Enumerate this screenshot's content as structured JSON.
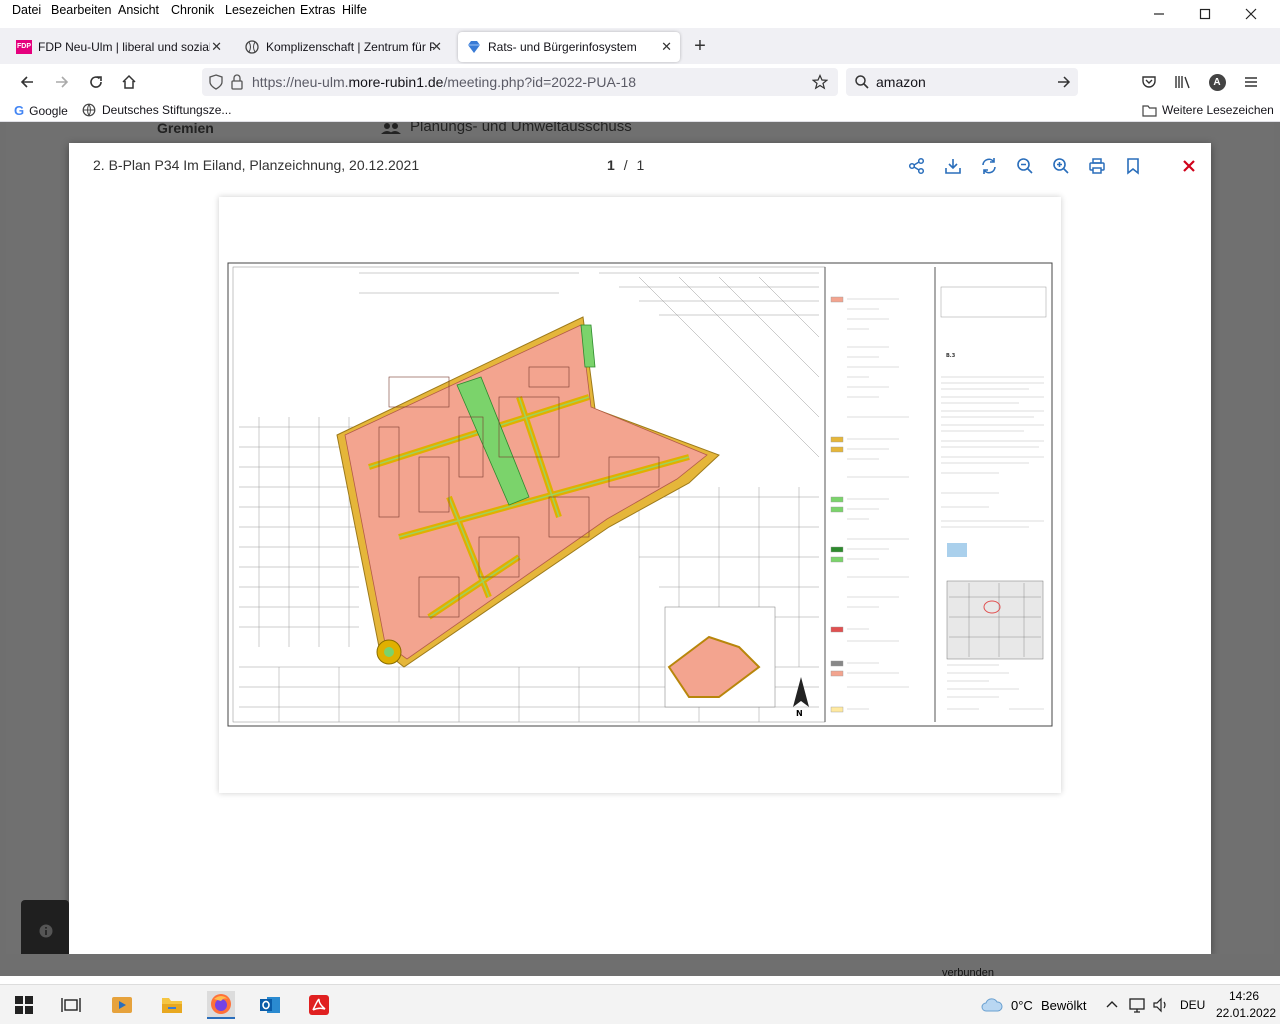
{
  "menubar": {
    "items": [
      "Datei",
      "Bearbeiten",
      "Ansicht",
      "Chronik",
      "Lesezeichen",
      "Extras",
      "Hilfe"
    ]
  },
  "tabs": [
    {
      "label": "FDP Neu-Ulm | liberal und sozial",
      "icon_text": "FDP",
      "active": false
    },
    {
      "label": "Komplizenschaft | Zentrum für P",
      "active": false
    },
    {
      "label": "Rats- und Bürgerinfosystem",
      "active": true
    }
  ],
  "url": {
    "prefix": "https://neu-ulm.",
    "domain": "more-rubin1.de",
    "path": "/meeting.php?id=2022-PUA-18"
  },
  "search": {
    "value": "amazon"
  },
  "account_initial": "A",
  "bookmarks": [
    {
      "label": "Google"
    },
    {
      "label": "Deutsches Stiftungsze..."
    }
  ],
  "bookmarks_other": "Weitere Lesezeichen",
  "background_page": {
    "label": "Gremien",
    "value": "Planungs- und Umweltausschuss"
  },
  "viewer": {
    "title": "2. B-Plan P34 Im Eiland, Planzeichnung, 20.12.2021",
    "page_current": "1",
    "page_sep": "/",
    "page_total": "1"
  },
  "status_text": "verbunden",
  "taskbar": {
    "weather_temp": "0°C",
    "weather_text": "Bewölkt",
    "lang": "DEU",
    "time": "14:26",
    "date": "22.01.2022"
  },
  "colors": {
    "brand_fdp": "#e5007d",
    "close_red": "#d0021b",
    "viewer_icon_blue": "#2a6ebb",
    "plan_building": "#f3a48f",
    "plan_road": "#e0b000",
    "plan_green": "#7bd36b"
  }
}
